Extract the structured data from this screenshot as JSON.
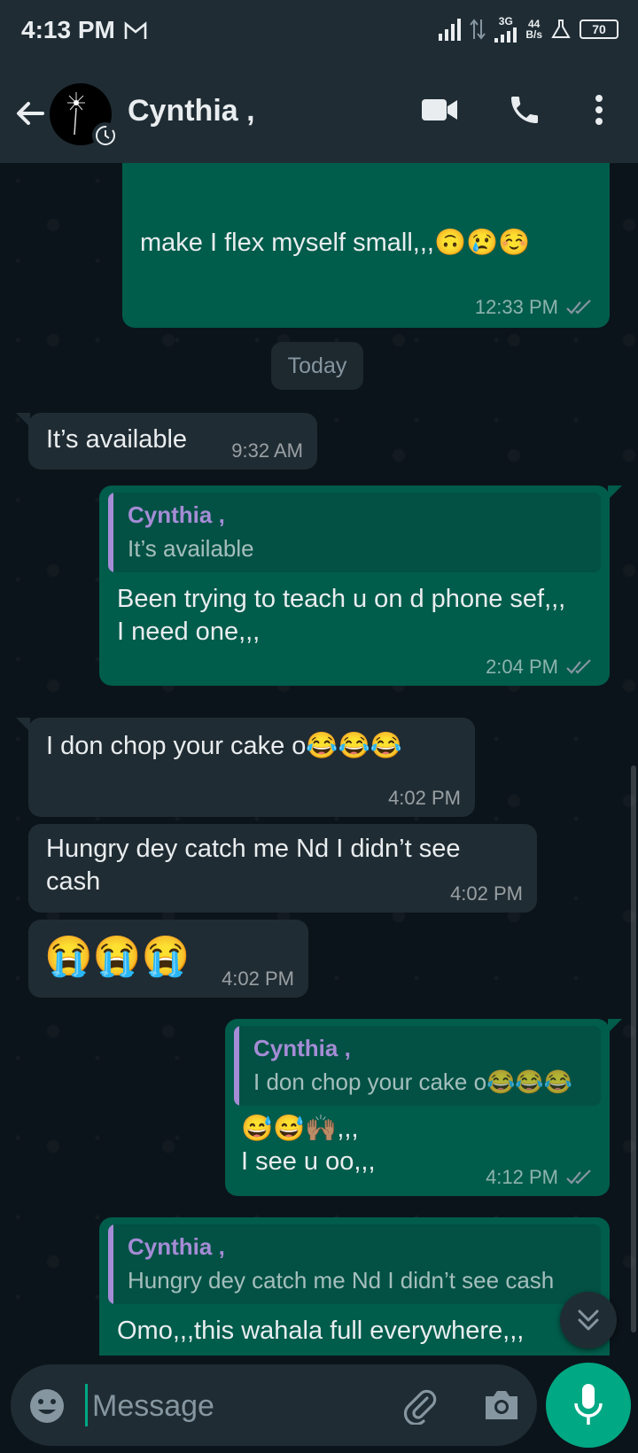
{
  "status_bar": {
    "time": "4:13 PM",
    "mail_glyph": "M",
    "network_3g": "3G",
    "speed_value": "44",
    "speed_unit": "B/s",
    "battery": "70"
  },
  "header": {
    "contact_name": "Cynthia ,",
    "icons": [
      "back-arrow-icon",
      "avatar",
      "disappearing-timer-icon",
      "video-call-icon",
      "voice-call-icon",
      "more-options-icon"
    ]
  },
  "date_divider": "Today",
  "messages": [
    {
      "dir": "out",
      "text": "make I flex myself small,,,🙃😢☺️",
      "time": "12:33 PM",
      "ticks": "read"
    },
    {
      "dir": "in",
      "text": "It’s available",
      "time": "9:32 AM"
    },
    {
      "dir": "out",
      "quote_name": "Cynthia ,",
      "quote_text": "It’s available",
      "text": "Been trying to teach u on d phone sef,,,\nI need one,,,",
      "time": "2:04 PM",
      "ticks": "read"
    },
    {
      "dir": "in",
      "text": "I don chop your cake o😂😂😂",
      "time": "4:02 PM"
    },
    {
      "dir": "in",
      "text": "Hungry dey catch me Nd I didn’t see cash",
      "time": "4:02 PM"
    },
    {
      "dir": "in",
      "text": "😭😭😭",
      "time": "4:02 PM"
    },
    {
      "dir": "out",
      "quote_name": "Cynthia ,",
      "quote_text": "I don chop your cake o😂😂😂",
      "text": "😅😅🙌🏽,,,\nI see u oo,,,",
      "time": "4:12 PM",
      "ticks": "read"
    },
    {
      "dir": "out",
      "quote_name": "Cynthia ,",
      "quote_text": "Hungry dey catch me Nd I didn’t see cash",
      "text": "Omo,,,this wahala full everywhere,,,",
      "time": "",
      "ticks": ""
    }
  ],
  "composer": {
    "placeholder": "Message",
    "value": ""
  },
  "colors": {
    "header_bg": "#1f2c34",
    "chat_bg": "#0b141a",
    "outgoing_bubble": "#005c4b",
    "incoming_bubble": "#202c33",
    "quote_accent": "#a58cd6",
    "read_ticks": "#8696a0",
    "accent_green": "#00a884"
  }
}
